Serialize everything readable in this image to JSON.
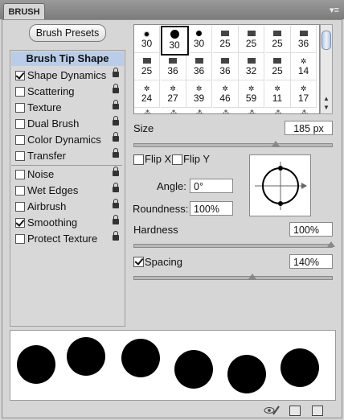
{
  "panel": {
    "tab_label": "BRUSH",
    "menu_glyph": "▾≡",
    "presets_button": "Brush Presets"
  },
  "options": {
    "header": "Brush Tip Shape",
    "items": [
      {
        "label": "Shape Dynamics",
        "checked": true,
        "locked": true
      },
      {
        "label": "Scattering",
        "checked": false,
        "locked": true
      },
      {
        "label": "Texture",
        "checked": false,
        "locked": true
      },
      {
        "label": "Dual Brush",
        "checked": false,
        "locked": true
      },
      {
        "label": "Color Dynamics",
        "checked": false,
        "locked": true
      },
      {
        "label": "Transfer",
        "checked": false,
        "locked": true
      },
      {
        "label": "Noise",
        "checked": false,
        "locked": true
      },
      {
        "label": "Wet Edges",
        "checked": false,
        "locked": true
      },
      {
        "label": "Airbrush",
        "checked": false,
        "locked": true
      },
      {
        "label": "Smoothing",
        "checked": true,
        "locked": true
      },
      {
        "label": "Protect Texture",
        "checked": false,
        "locked": true
      }
    ]
  },
  "brush_grid": {
    "rows": [
      [
        {
          "size": "30",
          "tip": "soft-dot-small"
        },
        {
          "size": "30",
          "tip": "hard-dot-large",
          "selected": true
        },
        {
          "size": "30",
          "tip": "hard-dot"
        },
        {
          "size": "25",
          "tip": "bristle"
        },
        {
          "size": "25",
          "tip": "bristle"
        },
        {
          "size": "25",
          "tip": "bristle"
        },
        {
          "size": "36",
          "tip": "bristle"
        }
      ],
      [
        {
          "size": "25",
          "tip": "bristle"
        },
        {
          "size": "36",
          "tip": "bristle"
        },
        {
          "size": "36",
          "tip": "bristle"
        },
        {
          "size": "36",
          "tip": "bristle"
        },
        {
          "size": "32",
          "tip": "bristle"
        },
        {
          "size": "25",
          "tip": "bristle"
        },
        {
          "size": "14",
          "tip": "scatter"
        }
      ],
      [
        {
          "size": "24",
          "tip": "scatter"
        },
        {
          "size": "27",
          "tip": "scatter"
        },
        {
          "size": "39",
          "tip": "scatter"
        },
        {
          "size": "46",
          "tip": "scatter"
        },
        {
          "size": "59",
          "tip": "scatter"
        },
        {
          "size": "11",
          "tip": "scatter"
        },
        {
          "size": "17",
          "tip": "scatter"
        }
      ]
    ]
  },
  "size": {
    "label": "Size",
    "value": "185 px",
    "fraction": 0.72
  },
  "flip": {
    "x_label": "Flip X",
    "y_label": "Flip Y",
    "x_checked": false,
    "y_checked": false
  },
  "angle": {
    "label": "Angle:",
    "value": "0°"
  },
  "roundness": {
    "label": "Roundness:",
    "value": "100%"
  },
  "hardness": {
    "label": "Hardness",
    "value": "100%",
    "fraction": 1.0
  },
  "spacing": {
    "label": "Spacing",
    "value": "140%",
    "checked": true,
    "fraction": 0.6
  },
  "bottom_icons": [
    "eye-brush-icon",
    "grid-panel-icon",
    "new-preset-icon"
  ]
}
